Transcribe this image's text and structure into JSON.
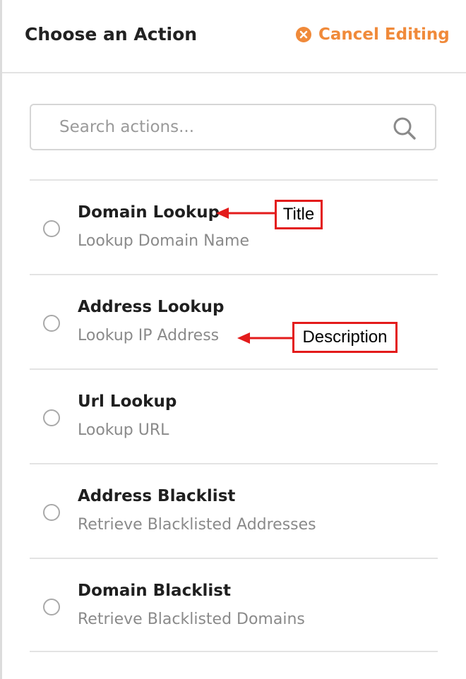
{
  "header": {
    "title": "Choose an Action",
    "cancel_label": "Cancel Editing",
    "cancel_icon": "close-circle-icon",
    "accent_color": "#f08a3a"
  },
  "search": {
    "placeholder": "Search actions...",
    "value": "",
    "icon": "search-icon"
  },
  "actions": [
    {
      "title": "Domain Lookup",
      "description": "Lookup Domain Name",
      "selected": false
    },
    {
      "title": "Address Lookup",
      "description": "Lookup IP Address",
      "selected": false
    },
    {
      "title": "Url Lookup",
      "description": "Lookup URL",
      "selected": false
    },
    {
      "title": "Address Blacklist",
      "description": "Retrieve Blacklisted Addresses",
      "selected": false
    },
    {
      "title": "Domain Blacklist",
      "description": "Retrieve Blacklisted Domains",
      "selected": false
    }
  ],
  "annotations": {
    "title_label": "Title",
    "description_label": "Description",
    "color": "#e31b1b"
  }
}
